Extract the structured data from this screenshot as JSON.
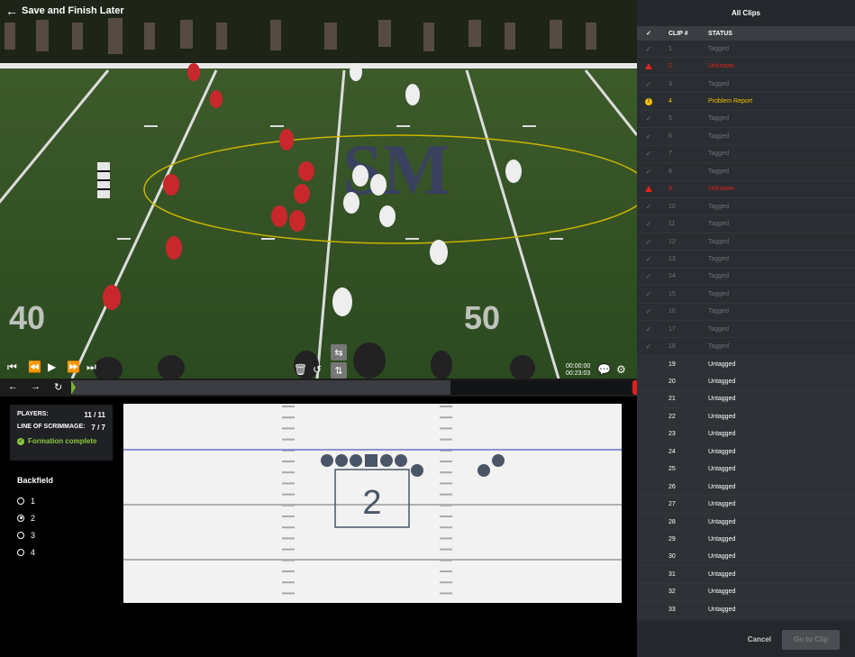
{
  "topbar": {
    "back_label": "Save and Finish Later"
  },
  "video": {
    "time_current": "00:00:00",
    "time_total": "00:23:03",
    "yard_numbers": [
      "40",
      "50"
    ],
    "field_letters": "SM"
  },
  "info": {
    "players_label": "PLAYERS:",
    "players_value": "11 / 11",
    "los_label": "LINE OF SCRIMMAGE:",
    "los_value": "7 / 7",
    "complete_label": "Formation complete"
  },
  "backfield": {
    "title": "Backfield",
    "options": [
      "1",
      "2",
      "3",
      "4"
    ],
    "selected": "2"
  },
  "formation": {
    "box_label": "2"
  },
  "panel": {
    "title": "All Clips",
    "col_clip": "CLIP #",
    "col_status": "STATUS",
    "clips": [
      {
        "num": "1",
        "status": "Tagged",
        "state": "tagged"
      },
      {
        "num": "2",
        "status": "Unknown",
        "state": "unknown"
      },
      {
        "num": "3",
        "status": "Tagged",
        "state": "tagged"
      },
      {
        "num": "4",
        "status": "Problem Report",
        "state": "problem"
      },
      {
        "num": "5",
        "status": "Tagged",
        "state": "tagged"
      },
      {
        "num": "6",
        "status": "Tagged",
        "state": "tagged"
      },
      {
        "num": "7",
        "status": "Tagged",
        "state": "tagged"
      },
      {
        "num": "8",
        "status": "Tagged",
        "state": "tagged"
      },
      {
        "num": "9",
        "status": "Unknown",
        "state": "unknown"
      },
      {
        "num": "10",
        "status": "Tagged",
        "state": "tagged"
      },
      {
        "num": "11",
        "status": "Tagged",
        "state": "tagged"
      },
      {
        "num": "12",
        "status": "Tagged",
        "state": "tagged"
      },
      {
        "num": "13",
        "status": "Tagged",
        "state": "tagged"
      },
      {
        "num": "14",
        "status": "Tagged",
        "state": "tagged"
      },
      {
        "num": "15",
        "status": "Tagged",
        "state": "tagged"
      },
      {
        "num": "16",
        "status": "Tagged",
        "state": "tagged"
      },
      {
        "num": "17",
        "status": "Tagged",
        "state": "tagged"
      },
      {
        "num": "18",
        "status": "Tagged",
        "state": "tagged"
      },
      {
        "num": "19",
        "status": "Untagged",
        "state": "untagged"
      },
      {
        "num": "20",
        "status": "Untagged",
        "state": "untagged"
      },
      {
        "num": "21",
        "status": "Untagged",
        "state": "untagged"
      },
      {
        "num": "22",
        "status": "Untagged",
        "state": "untagged"
      },
      {
        "num": "23",
        "status": "Untagged",
        "state": "untagged"
      },
      {
        "num": "24",
        "status": "Untagged",
        "state": "untagged"
      },
      {
        "num": "25",
        "status": "Untagged",
        "state": "untagged"
      },
      {
        "num": "26",
        "status": "Untagged",
        "state": "untagged"
      },
      {
        "num": "27",
        "status": "Untagged",
        "state": "untagged"
      },
      {
        "num": "28",
        "status": "Untagged",
        "state": "untagged"
      },
      {
        "num": "29",
        "status": "Untagged",
        "state": "untagged"
      },
      {
        "num": "30",
        "status": "Untagged",
        "state": "untagged"
      },
      {
        "num": "31",
        "status": "Untagged",
        "state": "untagged"
      },
      {
        "num": "32",
        "status": "Untagged",
        "state": "untagged"
      },
      {
        "num": "33",
        "status": "Untagged",
        "state": "untagged"
      }
    ],
    "cancel_label": "Cancel",
    "goto_label": "Go to Clip"
  },
  "colors": {
    "accent_green": "#8cc63f",
    "error_red": "#e0231f",
    "warning_yellow": "#f2c200",
    "line_blue": "#6b72c9"
  }
}
